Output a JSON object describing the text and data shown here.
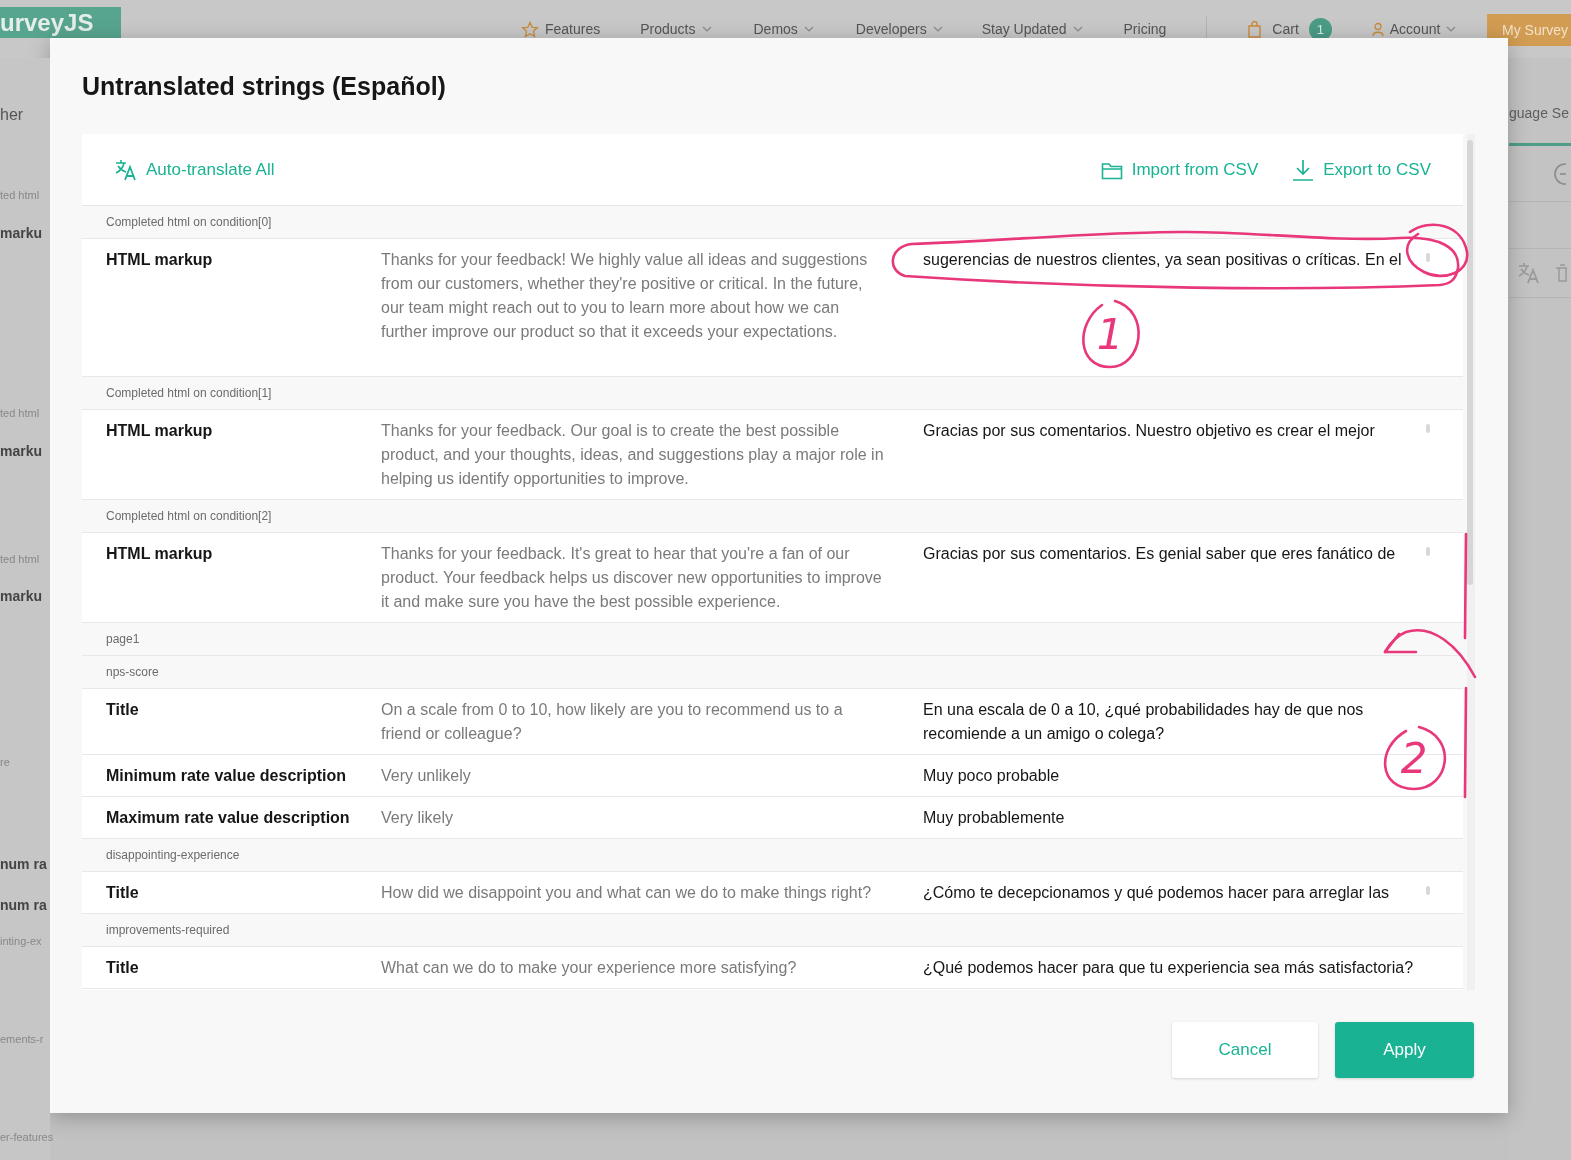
{
  "nav": {
    "logo": "urveyJS",
    "items": [
      {
        "label": "Features",
        "dropdown": false
      },
      {
        "label": "Products",
        "dropdown": true
      },
      {
        "label": "Demos",
        "dropdown": true
      },
      {
        "label": "Developers",
        "dropdown": true
      },
      {
        "label": "Stay Updated",
        "dropdown": true
      },
      {
        "label": "Pricing",
        "dropdown": false
      }
    ],
    "cart": {
      "label": "Cart",
      "count": "1"
    },
    "account": "Account",
    "my_surveys": "My Survey"
  },
  "background": {
    "left_texts": [
      {
        "kind": "tab",
        "text": "her"
      },
      {
        "kind": "group",
        "text": "ted html"
      },
      {
        "kind": "label",
        "text": "marku"
      },
      {
        "kind": "group",
        "text": "ted html"
      },
      {
        "kind": "label",
        "text": "marku"
      },
      {
        "kind": "group",
        "text": "ted html"
      },
      {
        "kind": "label",
        "text": "marku"
      },
      {
        "kind": "group",
        "text": "re"
      },
      {
        "kind": "label",
        "text": "num ra"
      },
      {
        "kind": "label",
        "text": "num ra"
      },
      {
        "kind": "group",
        "text": "inting-ex"
      },
      {
        "kind": "group",
        "text": "ements-r"
      },
      {
        "kind": "group",
        "text": "er-features"
      }
    ],
    "right_tab": "guage Se"
  },
  "dialog": {
    "title": "Untranslated strings (Español)",
    "toolbar": {
      "auto_translate": "Auto-translate All",
      "import": "Import from CSV",
      "export": "Export to CSV"
    },
    "rows": [
      {
        "kind": "group",
        "text": "Completed html on condition[0]"
      },
      {
        "kind": "item",
        "label": "HTML markup",
        "original": "Thanks for your feedback! We highly value all ideas and suggestions from our customers, whether they're positive or critical. In the future, our team might reach out to you to learn more about how we can further improve our product so that it exceeds your expectations.",
        "translation": "sugerencias de nuestros clientes, ya sean positivas o críticas. En el",
        "overflow": true
      },
      {
        "kind": "group",
        "text": "Completed html on condition[1]"
      },
      {
        "kind": "item",
        "label": "HTML markup",
        "original": "Thanks for your feedback. Our goal is to create the best possible product, and your thoughts, ideas, and suggestions play a major role in helping us identify opportunities to improve.",
        "translation": "Gracias por sus comentarios. Nuestro objetivo es crear el mejor",
        "overflow": true
      },
      {
        "kind": "group",
        "text": "Completed html on condition[2]"
      },
      {
        "kind": "item",
        "label": "HTML markup",
        "original": "Thanks for your feedback. It's great to hear that you're a fan of our product. Your feedback helps us discover new opportunities to improve it and make sure you have the best possible experience.",
        "translation": "Gracias por sus comentarios. Es genial saber que eres fanático de",
        "overflow": true
      },
      {
        "kind": "group",
        "text": "page1"
      },
      {
        "kind": "group",
        "text": "nps-score"
      },
      {
        "kind": "item",
        "label": "Title",
        "original": "On a scale from 0 to 10, how likely are you to recommend us to a friend or colleague?",
        "translation": "En una escala de 0 a 10, ¿qué probabilidades hay de que nos recomiende a un amigo o colega?",
        "overflow": false
      },
      {
        "kind": "item",
        "label": "Minimum rate value description",
        "original": "Very unlikely",
        "translation": "Muy poco probable",
        "overflow": false
      },
      {
        "kind": "item",
        "label": "Maximum rate value description",
        "original": "Very likely",
        "translation": "Muy probablemente",
        "overflow": false
      },
      {
        "kind": "group",
        "text": "disappointing-experience"
      },
      {
        "kind": "item",
        "label": "Title",
        "original": "How did we disappoint you and what can we do to make things right?",
        "translation": "¿Cómo te decepcionamos y qué podemos hacer para arreglar las",
        "overflow": true
      },
      {
        "kind": "group",
        "text": "improvements-required"
      },
      {
        "kind": "item",
        "label": "Title",
        "original": "What can we do to make your experience more satisfying?",
        "translation": "¿Qué podemos hacer para que tu experiencia sea más satisfactoria?",
        "overflow": false
      }
    ],
    "buttons": {
      "cancel": "Cancel",
      "apply": "Apply"
    }
  },
  "annotations": [
    {
      "kind": "ellipse"
    },
    {
      "kind": "circle"
    },
    {
      "kind": "number",
      "text": "1"
    },
    {
      "kind": "arrow"
    },
    {
      "kind": "line"
    },
    {
      "kind": "line"
    },
    {
      "kind": "number",
      "text": "2"
    }
  ]
}
